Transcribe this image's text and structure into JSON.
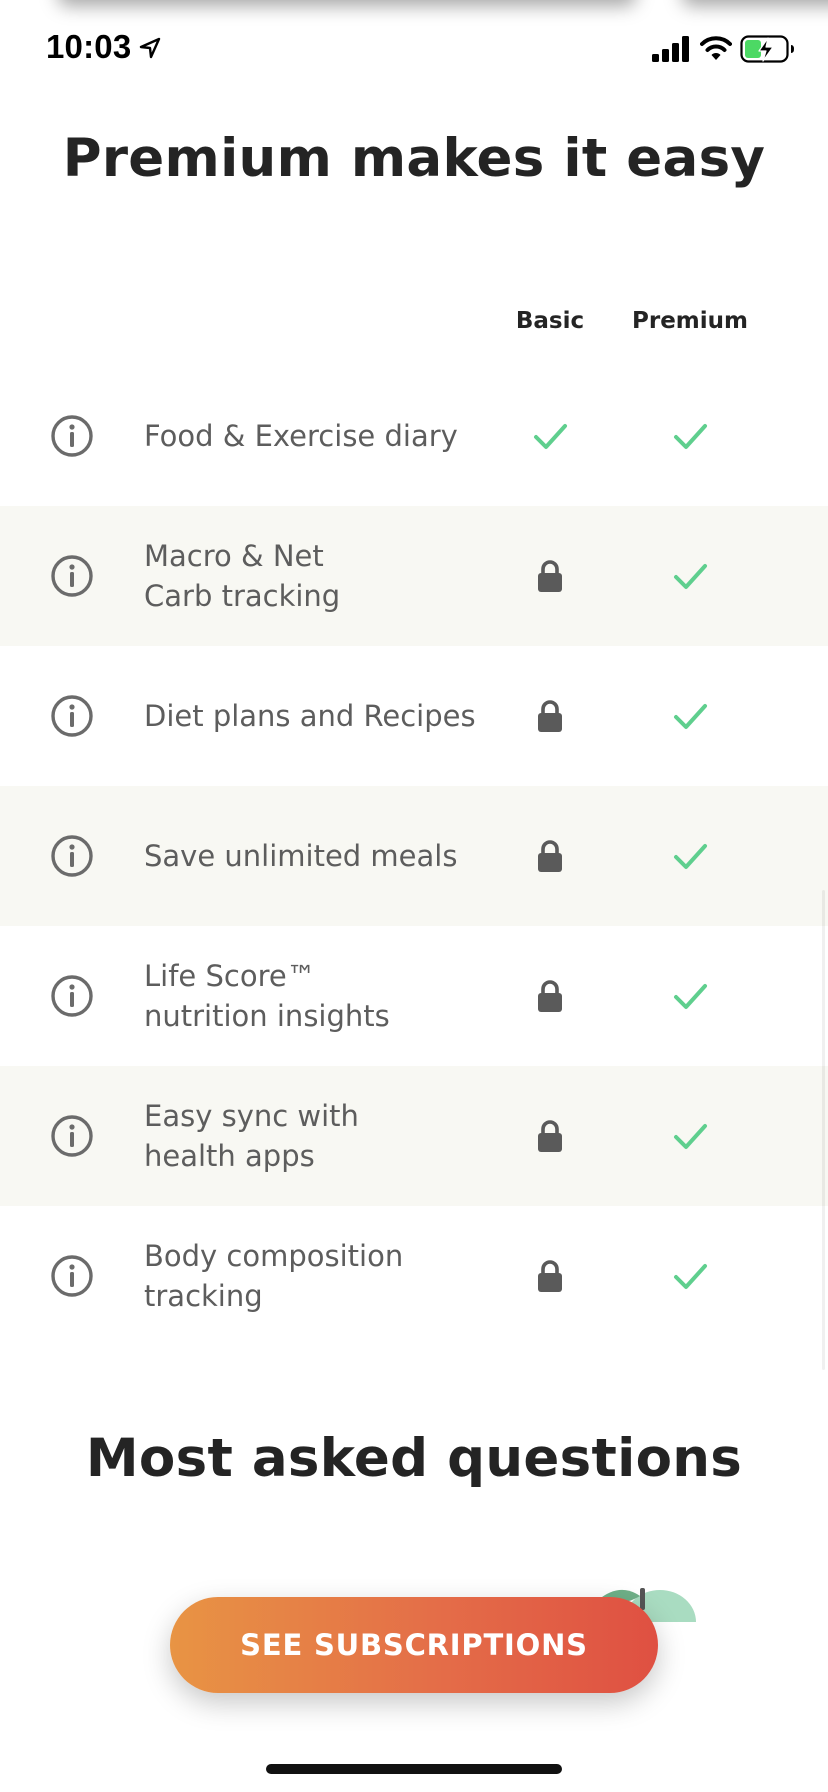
{
  "status_bar": {
    "time": "10:03",
    "location_icon": "location-arrow-icon",
    "signal_icon": "cellular-signal-icon",
    "wifi_icon": "wifi-icon",
    "battery_icon": "battery-charging-icon",
    "battery_level": 0.4
  },
  "header": {
    "title": "Premium makes it easy"
  },
  "comparison": {
    "columns": [
      "Basic",
      "Premium"
    ],
    "rows": [
      {
        "label": "Food & Exercise diary",
        "basic": "check",
        "premium": "check"
      },
      {
        "label": "Macro & Net\nCarb tracking",
        "basic": "lock",
        "premium": "check"
      },
      {
        "label": "Diet plans and Recipes",
        "basic": "lock",
        "premium": "check"
      },
      {
        "label": "Save unlimited meals",
        "basic": "lock",
        "premium": "check"
      },
      {
        "label": "Life Score™\nnutrition insights",
        "basic": "lock",
        "premium": "check"
      },
      {
        "label": "Easy sync with\nhealth apps",
        "basic": "lock",
        "premium": "check"
      },
      {
        "label": "Body composition\ntracking",
        "basic": "lock",
        "premium": "check"
      }
    ]
  },
  "faq": {
    "title": "Most asked questions"
  },
  "cta": {
    "label": "SEE SUBSCRIPTIONS"
  },
  "colors": {
    "check": "#5fcf8e",
    "lock": "#5a5a5a",
    "info": "#6b6b6b",
    "row_alt": "#f8f8f3",
    "cta_start": "#e89444",
    "cta_end": "#df5042"
  },
  "icons": {
    "info": "info-circle-icon",
    "check": "checkmark-icon",
    "lock": "lock-icon"
  }
}
